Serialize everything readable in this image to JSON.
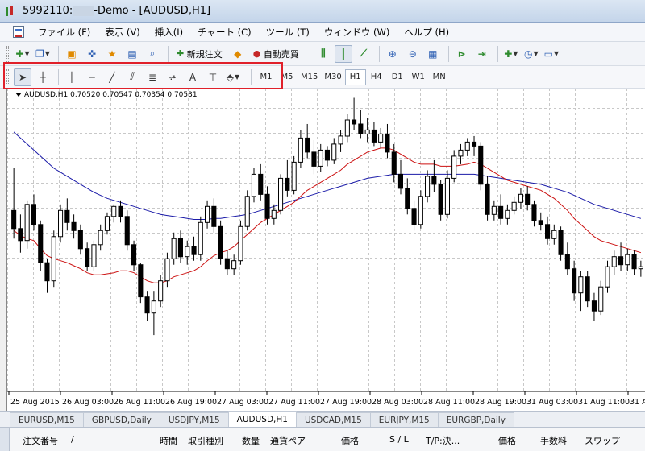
{
  "window": {
    "title_account": "5992110:",
    "title_suffix": "-Demo - [AUDUSD,H1]"
  },
  "menu": {
    "items": [
      "ファイル (F)",
      "表示 (V)",
      "挿入(I)",
      "チャート (C)",
      "ツール (T)",
      "ウィンドウ (W)",
      "ヘルプ (H)"
    ]
  },
  "toolbar1": {
    "new_order_label": "新規注文",
    "autotrade_label": "自動売買"
  },
  "toolbar2": {
    "text_tool_label": "A",
    "timeframes": [
      "M1",
      "M5",
      "M15",
      "M30",
      "H1",
      "H4",
      "D1",
      "W1",
      "MN"
    ],
    "active_timeframe": "H1"
  },
  "chart": {
    "info_label": "AUDUSD,H1  0.70520 0.70547 0.70354 0.70531",
    "colors": {
      "ma_fast": "#cc1111",
      "ma_slow": "#1a1aa8",
      "candle": "#000000",
      "grid": "#c8c8c8"
    }
  },
  "chart_data": {
    "type": "candlestick",
    "symbol": "AUDUSD",
    "timeframe": "H1",
    "x_tick_labels": [
      "25 Aug 2015",
      "26 Aug 03:00",
      "26 Aug 11:00",
      "26 Aug 19:00",
      "27 Aug 03:00",
      "27 Aug 11:00",
      "27 Aug 19:00",
      "28 Aug 03:00",
      "28 Aug 11:00",
      "28 Aug 19:00",
      "31 Aug 03:00",
      "31 Aug 11:00",
      "31 Au"
    ],
    "last_bar": {
      "open": 0.7052,
      "high": 0.70547,
      "low": 0.70354,
      "close": 0.70531
    },
    "price_range": [
      0.701,
      0.73
    ],
    "grid": true,
    "candles": [
      [
        0.719,
        0.7232,
        0.7162,
        0.7172
      ],
      [
        0.7172,
        0.7186,
        0.7148,
        0.716
      ],
      [
        0.716,
        0.72,
        0.7152,
        0.7196
      ],
      [
        0.7196,
        0.7206,
        0.717,
        0.7176
      ],
      [
        0.7176,
        0.718,
        0.713,
        0.7138
      ],
      [
        0.7138,
        0.7142,
        0.7108,
        0.712
      ],
      [
        0.712,
        0.717,
        0.7114,
        0.7164
      ],
      [
        0.7164,
        0.7196,
        0.7158,
        0.719
      ],
      [
        0.719,
        0.7202,
        0.717,
        0.7178
      ],
      [
        0.7178,
        0.7186,
        0.7162,
        0.717
      ],
      [
        0.717,
        0.7176,
        0.7146,
        0.7152
      ],
      [
        0.7152,
        0.7158,
        0.713,
        0.7134
      ],
      [
        0.7134,
        0.716,
        0.713,
        0.7156
      ],
      [
        0.7156,
        0.7176,
        0.715,
        0.717
      ],
      [
        0.717,
        0.7188,
        0.7166,
        0.7184
      ],
      [
        0.7184,
        0.7196,
        0.7178,
        0.7194
      ],
      [
        0.7194,
        0.72,
        0.7178,
        0.7184
      ],
      [
        0.7184,
        0.719,
        0.715,
        0.7156
      ],
      [
        0.7156,
        0.716,
        0.713,
        0.7136
      ],
      [
        0.7136,
        0.7138,
        0.7098,
        0.7104
      ],
      [
        0.7104,
        0.711,
        0.708,
        0.7088
      ],
      [
        0.7088,
        0.711,
        0.7066,
        0.71
      ],
      [
        0.71,
        0.7126,
        0.7094,
        0.712
      ],
      [
        0.712,
        0.7148,
        0.7114,
        0.7142
      ],
      [
        0.7142,
        0.7168,
        0.7136,
        0.7162
      ],
      [
        0.7162,
        0.717,
        0.7138,
        0.7144
      ],
      [
        0.7144,
        0.716,
        0.7136,
        0.7154
      ],
      [
        0.7154,
        0.7164,
        0.714,
        0.7146
      ],
      [
        0.7146,
        0.7184,
        0.714,
        0.7178
      ],
      [
        0.7178,
        0.72,
        0.7172,
        0.7194
      ],
      [
        0.7194,
        0.7202,
        0.7168,
        0.7174
      ],
      [
        0.7174,
        0.718,
        0.7136,
        0.7142
      ],
      [
        0.7142,
        0.715,
        0.7126,
        0.7132
      ],
      [
        0.7132,
        0.7146,
        0.7126,
        0.714
      ],
      [
        0.714,
        0.718,
        0.7136,
        0.7174
      ],
      [
        0.7174,
        0.721,
        0.717,
        0.7204
      ],
      [
        0.7204,
        0.7232,
        0.7198,
        0.7226
      ],
      [
        0.7226,
        0.7236,
        0.72,
        0.7206
      ],
      [
        0.7206,
        0.7214,
        0.7176,
        0.7182
      ],
      [
        0.7182,
        0.7196,
        0.7176,
        0.719
      ],
      [
        0.719,
        0.7226,
        0.7186,
        0.7222
      ],
      [
        0.7222,
        0.724,
        0.7204,
        0.721
      ],
      [
        0.721,
        0.7244,
        0.7206,
        0.7238
      ],
      [
        0.7238,
        0.727,
        0.7232,
        0.7262
      ],
      [
        0.7262,
        0.7276,
        0.7242,
        0.7248
      ],
      [
        0.7248,
        0.726,
        0.7226,
        0.7234
      ],
      [
        0.7234,
        0.7256,
        0.7228,
        0.725
      ],
      [
        0.725,
        0.7254,
        0.7234,
        0.724
      ],
      [
        0.724,
        0.7262,
        0.7236,
        0.7256
      ],
      [
        0.7256,
        0.727,
        0.7248,
        0.7264
      ],
      [
        0.7264,
        0.7286,
        0.7258,
        0.728
      ],
      [
        0.728,
        0.7302,
        0.727,
        0.7276
      ],
      [
        0.7276,
        0.729,
        0.7262,
        0.7266
      ],
      [
        0.7266,
        0.7282,
        0.7258,
        0.727
      ],
      [
        0.727,
        0.7278,
        0.7254,
        0.7258
      ],
      [
        0.7258,
        0.7272,
        0.7252,
        0.7266
      ],
      [
        0.7266,
        0.7276,
        0.7242,
        0.7248
      ],
      [
        0.7248,
        0.7256,
        0.7218,
        0.7226
      ],
      [
        0.7226,
        0.724,
        0.7206,
        0.7212
      ],
      [
        0.7212,
        0.7222,
        0.7186,
        0.7192
      ],
      [
        0.7192,
        0.72,
        0.717,
        0.7176
      ],
      [
        0.7176,
        0.721,
        0.7172,
        0.7204
      ],
      [
        0.7204,
        0.723,
        0.7198,
        0.7224
      ],
      [
        0.7224,
        0.724,
        0.7208,
        0.7216
      ],
      [
        0.7216,
        0.722,
        0.718,
        0.7186
      ],
      [
        0.7186,
        0.723,
        0.7182,
        0.7222
      ],
      [
        0.7222,
        0.725,
        0.7218,
        0.7244
      ],
      [
        0.7244,
        0.7256,
        0.7236,
        0.725
      ],
      [
        0.725,
        0.7262,
        0.7244,
        0.7258
      ],
      [
        0.7258,
        0.7264,
        0.7244,
        0.7254
      ],
      [
        0.7254,
        0.7258,
        0.721,
        0.7216
      ],
      [
        0.7216,
        0.7224,
        0.718,
        0.7186
      ],
      [
        0.7186,
        0.72,
        0.718,
        0.7194
      ],
      [
        0.7194,
        0.7206,
        0.7176,
        0.7182
      ],
      [
        0.7182,
        0.7196,
        0.7176,
        0.719
      ],
      [
        0.719,
        0.7204,
        0.7186,
        0.7198
      ],
      [
        0.7198,
        0.7212,
        0.7192,
        0.7206
      ],
      [
        0.7206,
        0.7214,
        0.719,
        0.7196
      ],
      [
        0.7196,
        0.72,
        0.7174,
        0.718
      ],
      [
        0.718,
        0.7188,
        0.717,
        0.7176
      ],
      [
        0.7176,
        0.7184,
        0.7156,
        0.7162
      ],
      [
        0.7162,
        0.7176,
        0.7156,
        0.717
      ],
      [
        0.717,
        0.7174,
        0.714,
        0.7146
      ],
      [
        0.7146,
        0.7158,
        0.7126,
        0.7132
      ],
      [
        0.7132,
        0.714,
        0.71,
        0.7108
      ],
      [
        0.7108,
        0.713,
        0.709,
        0.7124
      ],
      [
        0.7124,
        0.713,
        0.7094,
        0.71
      ],
      [
        0.71,
        0.7108,
        0.708,
        0.709
      ],
      [
        0.709,
        0.712,
        0.7086,
        0.7114
      ],
      [
        0.7114,
        0.714,
        0.7108,
        0.7134
      ],
      [
        0.7134,
        0.715,
        0.7126,
        0.7144
      ],
      [
        0.7144,
        0.7158,
        0.713,
        0.7136
      ],
      [
        0.7136,
        0.7152,
        0.713,
        0.7146
      ],
      [
        0.7146,
        0.715,
        0.7126,
        0.7132
      ],
      [
        0.7132,
        0.714,
        0.7124,
        0.7134
      ]
    ],
    "ma_fast": [
      0.717,
      0.7165,
      0.7162,
      0.716,
      0.7152,
      0.7145,
      0.7142,
      0.714,
      0.7138,
      0.7135,
      0.7132,
      0.7128,
      0.7126,
      0.7126,
      0.7127,
      0.7128,
      0.713,
      0.713,
      0.7128,
      0.7124,
      0.712,
      0.7118,
      0.7118,
      0.712,
      0.7124,
      0.7126,
      0.7128,
      0.713,
      0.7134,
      0.714,
      0.7145,
      0.7148,
      0.715,
      0.7154,
      0.716,
      0.7166,
      0.7172,
      0.7178,
      0.7182,
      0.7186,
      0.719,
      0.7194,
      0.7198,
      0.7204,
      0.721,
      0.7214,
      0.7218,
      0.7222,
      0.7226,
      0.723,
      0.7236,
      0.724,
      0.7244,
      0.7248,
      0.725,
      0.7252,
      0.7252,
      0.725,
      0.7246,
      0.7242,
      0.7238,
      0.7236,
      0.7236,
      0.7236,
      0.7234,
      0.7234,
      0.7234,
      0.7235,
      0.7236,
      0.7238,
      0.7236,
      0.7232,
      0.7228,
      0.7224,
      0.722,
      0.7218,
      0.7216,
      0.7214,
      0.7212,
      0.721,
      0.7206,
      0.7202,
      0.7196,
      0.719,
      0.7182,
      0.7176,
      0.717,
      0.7164,
      0.716,
      0.7158,
      0.7156,
      0.7154,
      0.7152,
      0.715,
      0.7148
    ],
    "ma_slow": [
      0.7268,
      0.7262,
      0.7256,
      0.725,
      0.7244,
      0.7238,
      0.7232,
      0.7228,
      0.7224,
      0.722,
      0.7216,
      0.7212,
      0.7208,
      0.7205,
      0.7202,
      0.72,
      0.7198,
      0.7196,
      0.7194,
      0.7192,
      0.719,
      0.7188,
      0.7186,
      0.7185,
      0.7184,
      0.7183,
      0.7182,
      0.7181,
      0.7181,
      0.7181,
      0.7182,
      0.7182,
      0.7183,
      0.7184,
      0.7185,
      0.7186,
      0.7188,
      0.719,
      0.7192,
      0.7194,
      0.7196,
      0.7198,
      0.72,
      0.7202,
      0.7204,
      0.7206,
      0.7208,
      0.721,
      0.7212,
      0.7214,
      0.7216,
      0.7218,
      0.722,
      0.7222,
      0.7223,
      0.7224,
      0.7225,
      0.7226,
      0.7226,
      0.7226,
      0.7226,
      0.7226,
      0.7226,
      0.7226,
      0.7226,
      0.7226,
      0.7226,
      0.7226,
      0.7226,
      0.7226,
      0.7225,
      0.7224,
      0.7223,
      0.7222,
      0.7221,
      0.722,
      0.7219,
      0.7218,
      0.7217,
      0.7216,
      0.7214,
      0.7212,
      0.721,
      0.7208,
      0.7205,
      0.7202,
      0.7199,
      0.7196,
      0.7194,
      0.7192,
      0.719,
      0.7188,
      0.7186,
      0.7184,
      0.7182
    ]
  },
  "tabs": [
    "EURUSD,M15",
    "GBPUSD,Daily",
    "USDJPY,M15",
    "AUDUSD,H1",
    "USDCAD,M15",
    "EURJPY,M15",
    "EURGBP,Daily"
  ],
  "active_tab": "AUDUSD,H1",
  "terminal": {
    "columns": [
      "注文番号",
      "/",
      "時間",
      "取引種別",
      "数量",
      "通貨ペア",
      "価格",
      "S / L",
      "T/P:決...",
      "価格",
      "手数料",
      "スワップ"
    ]
  }
}
